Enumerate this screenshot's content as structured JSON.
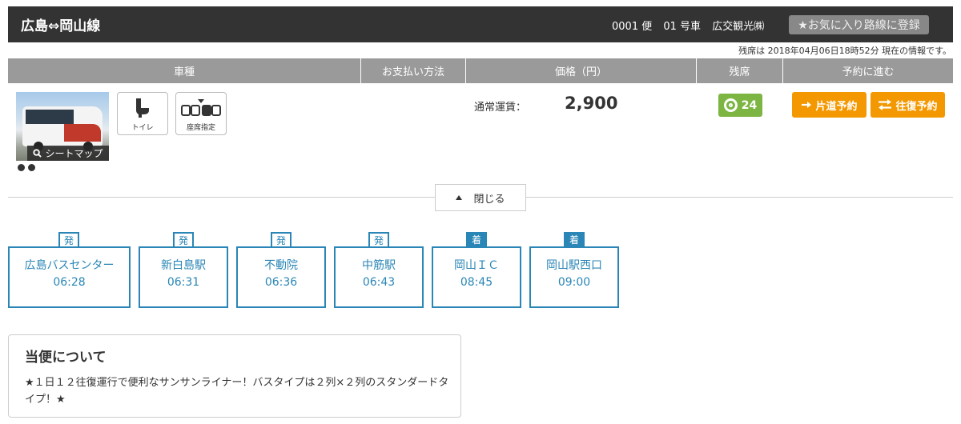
{
  "header": {
    "route_title": "広島⇔岡山線",
    "flight_no": "0001 便",
    "car_no": "01 号車",
    "operator": "広交観光㈱",
    "favorite_label": "★お気に入り路線に登録"
  },
  "updated_notice": "残席は 2018年04月06日18時52分 現在の情報です。",
  "table_headers": {
    "vehicle": "車種",
    "payment": "お支払い方法",
    "price": "価格（円）",
    "seats": "残席",
    "reserve": "予約に進む"
  },
  "vehicle": {
    "seatmap_label": "シートマップ",
    "amenities": [
      {
        "label": "トイレ",
        "icon": "toilet-icon"
      },
      {
        "label": "座席指定",
        "icon": "seat-reservation-icon"
      }
    ]
  },
  "fare": {
    "label": "通常運賃：",
    "value": "2,900"
  },
  "seats_left": "24",
  "booking": {
    "one_way_label": "片道予約",
    "round_trip_label": "往復予約"
  },
  "close_label": "閉じる",
  "stops": [
    {
      "tag": "発",
      "type": "dep",
      "name": "広島バスセンター",
      "time": "06:28"
    },
    {
      "tag": "発",
      "type": "dep",
      "name": "新白島駅",
      "time": "06:31"
    },
    {
      "tag": "発",
      "type": "dep",
      "name": "不動院",
      "time": "06:36"
    },
    {
      "tag": "発",
      "type": "dep",
      "name": "中筋駅",
      "time": "06:43"
    },
    {
      "tag": "着",
      "type": "arr",
      "name": "岡山ＩＣ",
      "time": "08:45"
    },
    {
      "tag": "着",
      "type": "arr",
      "name": "岡山駅西口",
      "time": "09:00"
    }
  ],
  "about": {
    "title": "当便について",
    "text": "★１日１２往復運行で便利なサンサンライナー！バスタイプは２列×２列のスタンダードタイプ！★"
  },
  "colors": {
    "header_bg": "#333333",
    "table_head_bg": "#9a9a9a",
    "accent_orange": "#f39800",
    "seats_green": "#7cb542",
    "stop_blue": "#2a86b6"
  }
}
